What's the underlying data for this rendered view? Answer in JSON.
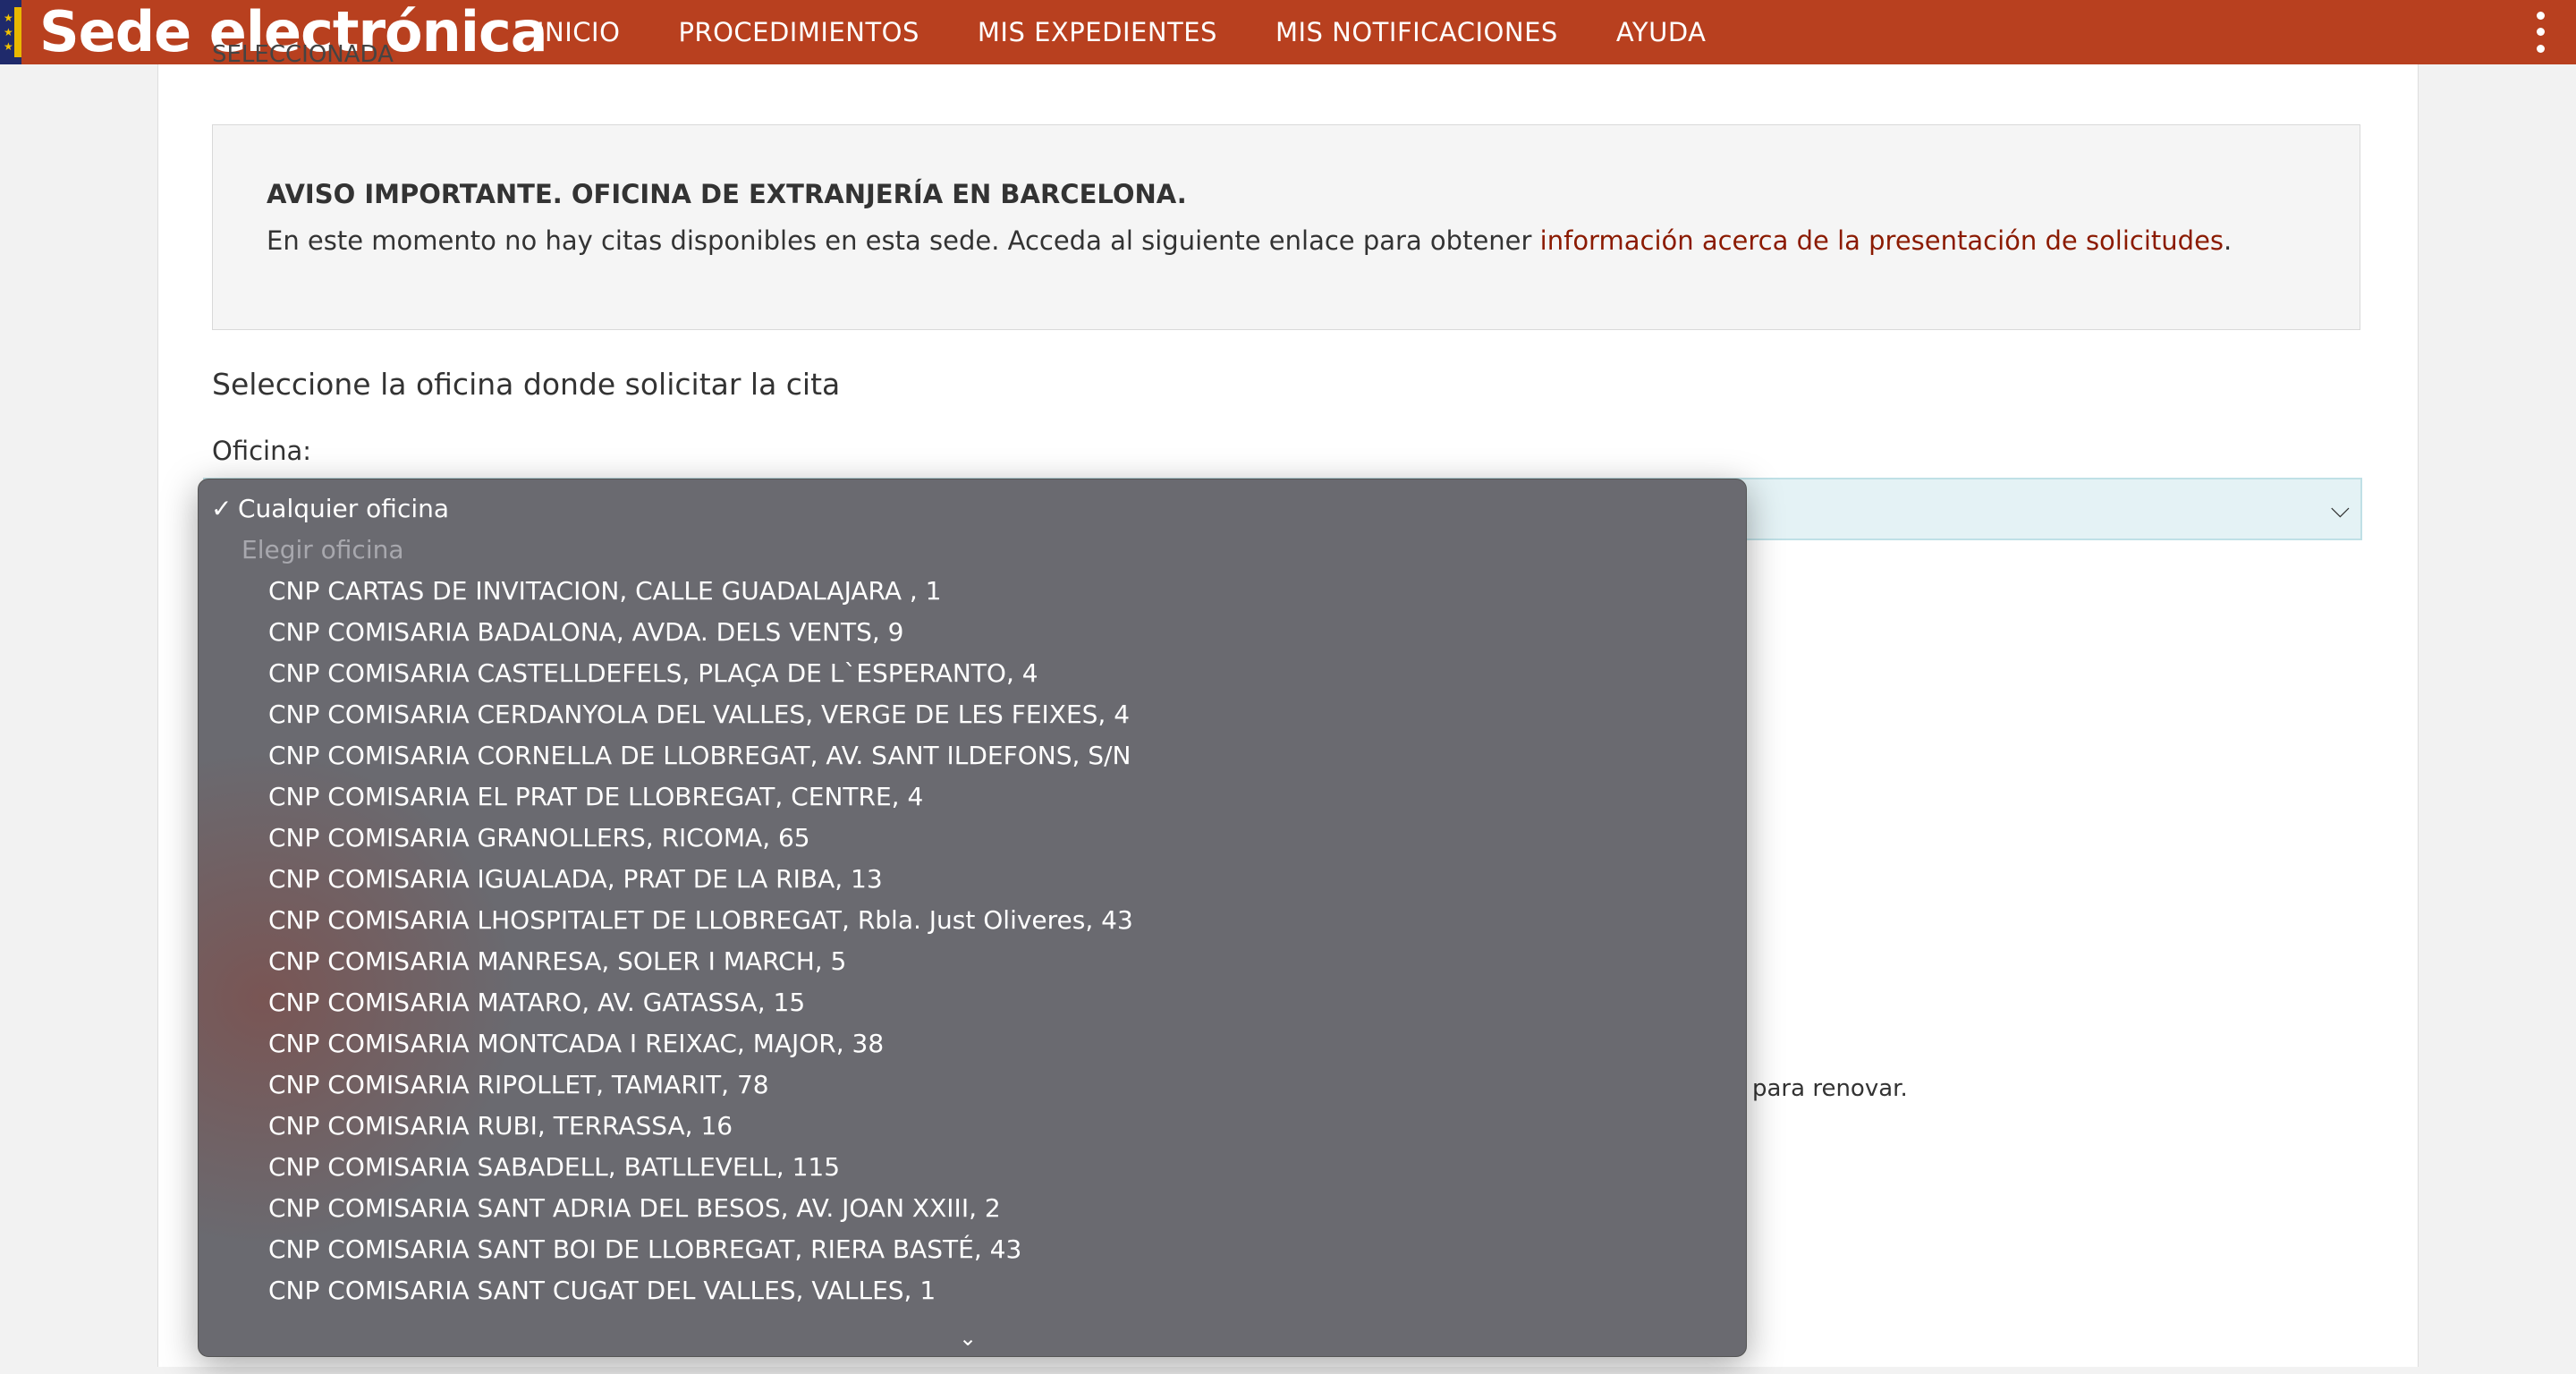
{
  "header": {
    "brand": "Sede electrónica",
    "nav": [
      "INICIO",
      "PROCEDIMIENTOS",
      "MIS EXPEDIENTES",
      "MIS NOTIFICACIONES",
      "AYUDA"
    ]
  },
  "page": {
    "cut_heading": "SELECCIONADA",
    "notice_title": "AVISO IMPORTANTE. OFICINA DE EXTRANJERÍA EN BARCELONA.",
    "notice_text": "En este momento no hay citas disponibles en esta sede. Acceda al siguiente enlace para obtener ",
    "notice_link": "información acerca de la presentación de solicitudes",
    "notice_end": ".",
    "section_title": "Seleccione la oficina donde solicitar la cita",
    "office_label": "Oficina:",
    "para_tail": "para renovar."
  },
  "dropdown": {
    "selected": "Cualquier oficina",
    "placeholder": "Elegir oficina",
    "options": [
      "CNP CARTAS DE INVITACION, CALLE GUADALAJARA , 1",
      "CNP COMISARIA BADALONA, AVDA. DELS VENTS, 9",
      "CNP COMISARIA CASTELLDEFELS, PLAÇA DE L`ESPERANTO, 4",
      "CNP COMISARIA CERDANYOLA DEL VALLES, VERGE DE LES FEIXES, 4",
      "CNP COMISARIA CORNELLA DE LLOBREGAT, AV. SANT ILDEFONS, S/N",
      "CNP COMISARIA EL PRAT DE LLOBREGAT, CENTRE, 4",
      "CNP COMISARIA GRANOLLERS, RICOMA, 65",
      "CNP COMISARIA IGUALADA, PRAT DE LA RIBA, 13",
      "CNP COMISARIA LHOSPITALET DE LLOBREGAT, Rbla. Just Oliveres, 43",
      "CNP COMISARIA MANRESA, SOLER I MARCH, 5",
      "CNP COMISARIA MATARO, AV. GATASSA, 15",
      "CNP COMISARIA MONTCADA I REIXAC, MAJOR, 38",
      "CNP COMISARIA RIPOLLET, TAMARIT, 78",
      "CNP COMISARIA RUBI, TERRASSA, 16",
      "CNP COMISARIA SABADELL, BATLLEVELL, 115",
      "CNP COMISARIA SANT ADRIA DEL BESOS, AV. JOAN XXIII, 2",
      "CNP COMISARIA SANT BOI DE LLOBREGAT, RIERA BASTÉ, 43",
      "CNP COMISARIA SANT CUGAT DEL VALLES, VALLES, 1"
    ]
  }
}
